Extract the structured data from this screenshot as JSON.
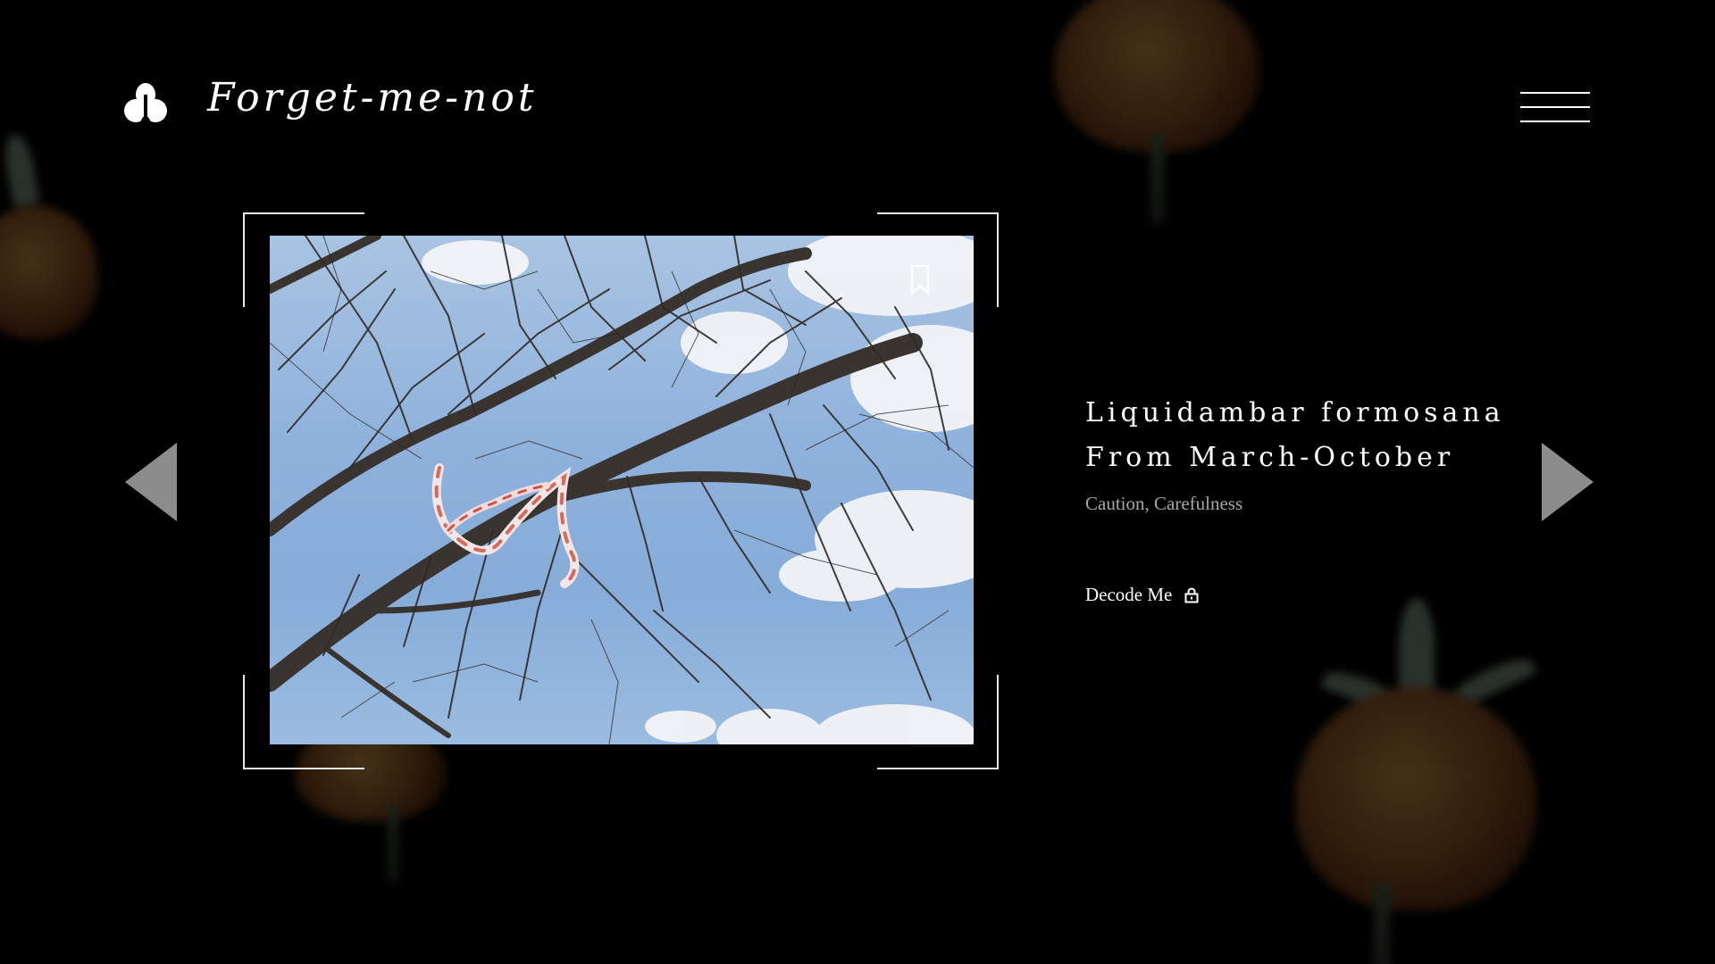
{
  "header": {
    "brand_name": "Forget-me-not",
    "logo_icon": "flower-bud-logo",
    "menu_icon": "hamburger-menu-icon"
  },
  "gallery": {
    "photo_description": "bare-tree-branches-with-ribbon-photo",
    "bookmark_icon": "bookmark-icon",
    "prev_icon": "triangle-left-icon",
    "next_icon": "triangle-right-icon"
  },
  "plant": {
    "title_line1": "Liquidambar formosana",
    "title_line2": "From March-October",
    "meaning": "Caution, Carefulness",
    "decode_label": "Decode Me",
    "decode_icon": "lock-icon"
  },
  "colors": {
    "background": "#000000",
    "text": "#ffffff",
    "muted_text": "#a6a6a6",
    "arrow": "#8c8c8c",
    "frame": "#e6e6e6"
  }
}
